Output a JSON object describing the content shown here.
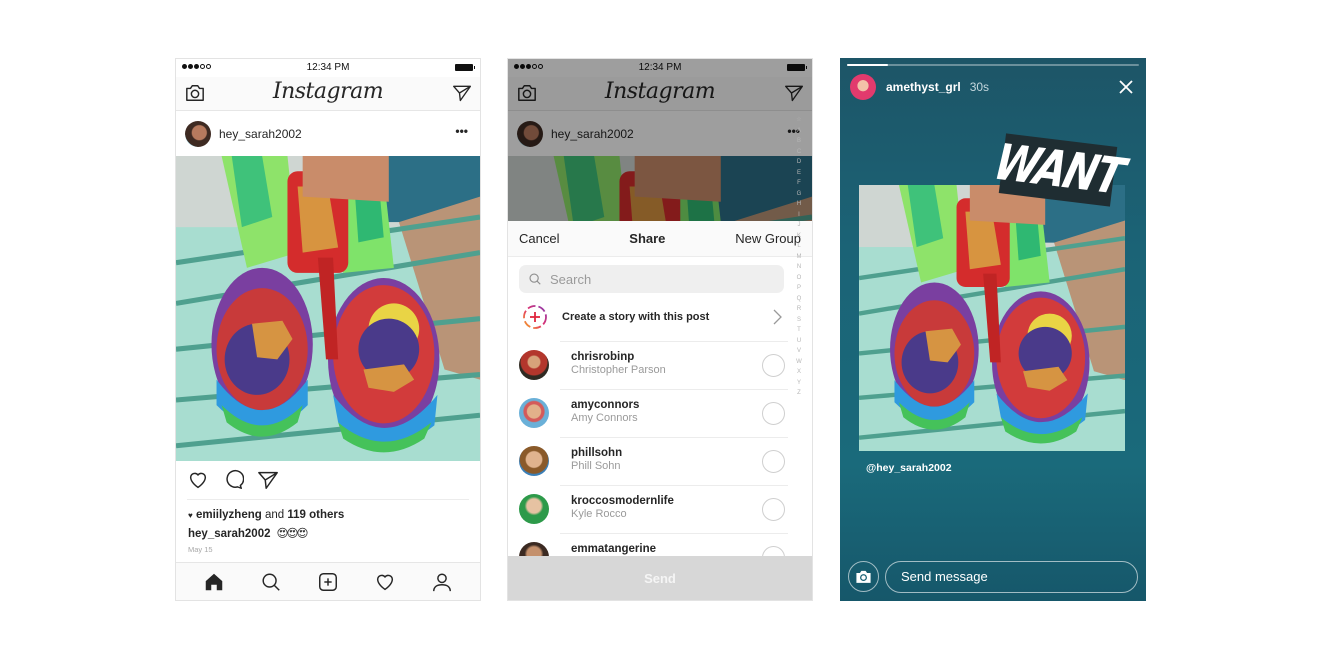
{
  "status_bar": {
    "time": "12:34 PM"
  },
  "feed": {
    "app_title": "Instagram",
    "post": {
      "username": "hey_sarah2002",
      "more_label": "•••",
      "liked_by": "emiilyzheng",
      "likes_suffix": "and",
      "likes_count": "119 others",
      "caption_user": "hey_sarah2002",
      "caption_text": "😍😍😍",
      "date": "May 15"
    },
    "icons": {
      "camera": "camera-icon",
      "direct": "direct-message-icon",
      "like": "heart-icon",
      "comment": "comment-icon",
      "share": "share-icon",
      "home": "home-icon",
      "search": "search-icon",
      "add": "add-post-icon",
      "activity": "activity-heart-icon",
      "profile": "profile-icon"
    }
  },
  "share_sheet": {
    "app_title": "Instagram",
    "post_username": "hey_sarah2002",
    "more_label": "•••",
    "cancel_label": "Cancel",
    "title": "Share",
    "new_group_label": "New Group",
    "search_placeholder": "Search",
    "create_story_label": "Create a story with this post",
    "contacts": [
      {
        "username": "chrisrobinp",
        "name": "Christopher Parson",
        "selected": false
      },
      {
        "username": "amyconnors",
        "name": "Amy Connors",
        "selected": false
      },
      {
        "username": "phillsohn",
        "name": "Phill Sohn",
        "selected": false
      },
      {
        "username": "kroccosmodernlife",
        "name": "Kyle Rocco",
        "selected": false
      },
      {
        "username": "emmatangerine",
        "name": "",
        "selected": false
      }
    ],
    "alpha_index": [
      "☆",
      "A",
      "B",
      "C",
      "D",
      "E",
      "F",
      "G",
      "H",
      "I",
      "J",
      "K",
      "L",
      "M",
      "N",
      "O",
      "P",
      "Q",
      "R",
      "S",
      "T",
      "U",
      "V",
      "W",
      "X",
      "Y",
      "Z"
    ],
    "send_label": "Send"
  },
  "story": {
    "username": "amethyst_grl",
    "time_ago": "30s",
    "progress": 0.14,
    "sticker_text": "WANT",
    "mention": "@hey_sarah2002",
    "message_placeholder": "Send message",
    "colors": {
      "background": "#1b6376"
    }
  }
}
